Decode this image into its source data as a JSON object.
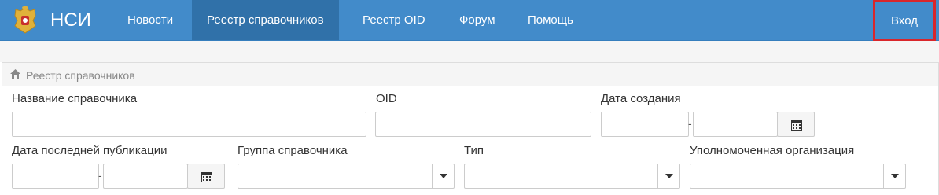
{
  "brand": {
    "title": "НСИ",
    "emblem_icon": "coat-of-arms-icon"
  },
  "nav": {
    "items": [
      {
        "label": "Новости",
        "active": false
      },
      {
        "label": "Реестр справочников",
        "active": true
      },
      {
        "label": "Реестр OID",
        "active": false
      },
      {
        "label": "Форум",
        "active": false
      },
      {
        "label": "Помощь",
        "active": false
      }
    ],
    "login": "Вход"
  },
  "breadcrumb": {
    "icon": "home-icon",
    "text": "Реестр справочников"
  },
  "filters": {
    "name": {
      "label": "Название справочника",
      "value": "",
      "placeholder": ""
    },
    "oid": {
      "label": "OID",
      "value": "",
      "placeholder": ""
    },
    "created": {
      "label": "Дата создания",
      "from": "",
      "to": "",
      "separator": "-",
      "icon": "calendar-icon"
    },
    "published": {
      "label": "Дата последней публикации",
      "from": "",
      "to": "",
      "separator": "-",
      "icon": "calendar-icon"
    },
    "group": {
      "label": "Группа справочника",
      "value": "",
      "icon": "caret-down-icon"
    },
    "type": {
      "label": "Тип",
      "value": "",
      "icon": "caret-down-icon"
    },
    "organization": {
      "label": "Уполномоченная организация",
      "value": "",
      "icon": "caret-down-icon"
    }
  },
  "colors": {
    "navbar": "#428bca",
    "nav_active": "#3071a9",
    "highlight": "#d9262b"
  }
}
